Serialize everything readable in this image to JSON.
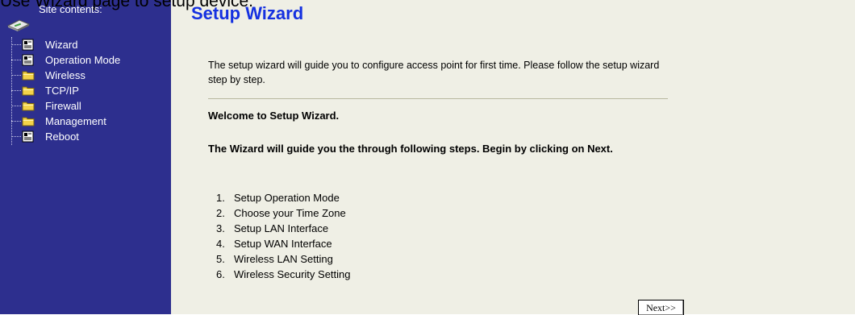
{
  "caption": "Use Wizard page to setup device.",
  "sidebar": {
    "title": "Site contents:",
    "icon": "disk-icon",
    "items": [
      {
        "label": "Wizard",
        "icon": "page-icon"
      },
      {
        "label": "Operation Mode",
        "icon": "page-icon"
      },
      {
        "label": "Wireless",
        "icon": "folder-icon"
      },
      {
        "label": "TCP/IP",
        "icon": "folder-icon"
      },
      {
        "label": "Firewall",
        "icon": "folder-icon"
      },
      {
        "label": "Management",
        "icon": "folder-icon"
      },
      {
        "label": "Reboot",
        "icon": "page-icon"
      }
    ]
  },
  "main": {
    "title": "Setup Wizard",
    "intro": "The setup wizard will guide you to configure access point for first time. Please follow the setup wizard step by step.",
    "welcome": "Welcome to Setup Wizard.",
    "guide": "The Wizard will guide you the through following steps. Begin by clicking on Next.",
    "steps": [
      {
        "num": "1.",
        "label": "Setup Operation Mode"
      },
      {
        "num": "2.",
        "label": "Choose your Time Zone"
      },
      {
        "num": "3.",
        "label": "Setup LAN Interface"
      },
      {
        "num": "4.",
        "label": "Setup WAN Interface"
      },
      {
        "num": "5.",
        "label": "Wireless LAN Setting"
      },
      {
        "num": "6.",
        "label": "Wireless Security Setting"
      }
    ],
    "next_label": "Next>>"
  },
  "colors": {
    "sidebar_bg": "#2d2f8e",
    "main_bg": "#efefe5",
    "title": "#1531e0"
  }
}
